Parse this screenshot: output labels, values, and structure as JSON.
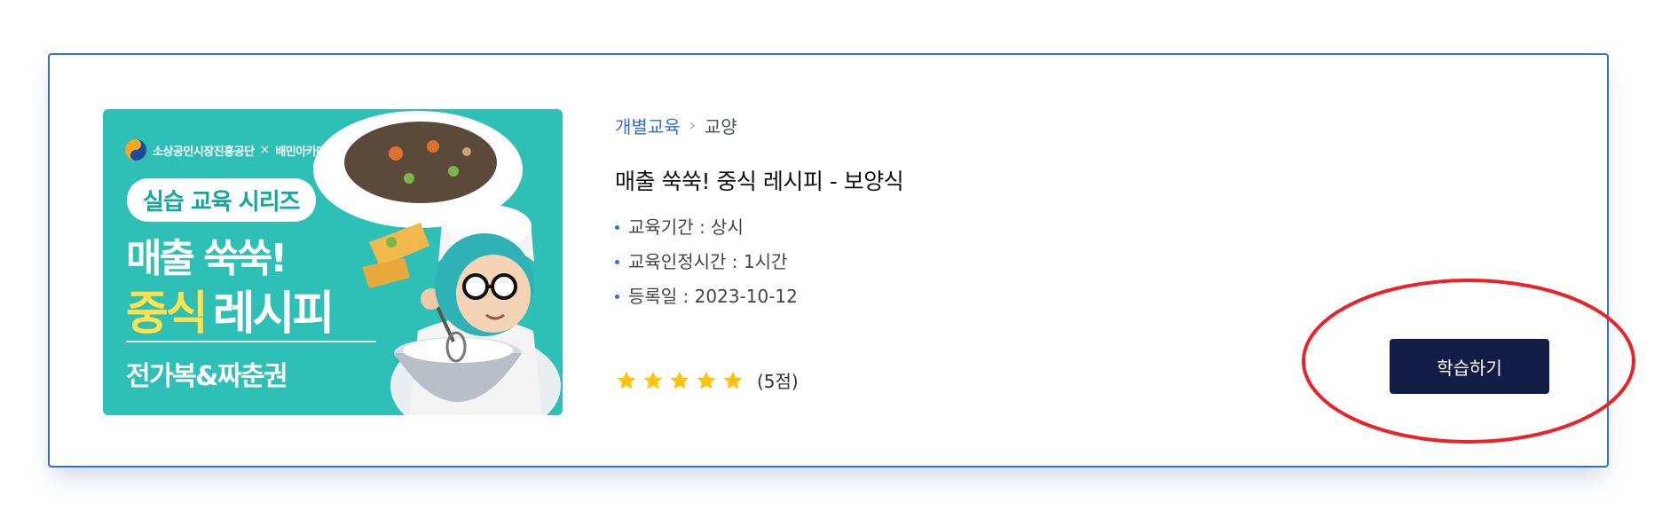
{
  "course": {
    "thumbnail": {
      "brand_left": "소상공인시장진흥공단",
      "brand_x": "×",
      "brand_right": "배민아카데미",
      "series": "실습 교육 시리즈",
      "headline_1": "매출 쑥쑥!",
      "headline_2_highlight": "중식",
      "headline_2_rest": "레시피",
      "author": "전가복&짜춘권"
    },
    "breadcrumb": {
      "category": "개별교육",
      "separator": "›",
      "subcategory": "교양"
    },
    "title": "매출 쑥쑥! 중식 레시피 - 보양식",
    "info": [
      "교육기간 : 상시",
      "교육인정시간 : 1시간",
      "등록일 : 2023-10-12"
    ],
    "rating": {
      "stars": 5,
      "label": "(5점)",
      "star_icon": "star-icon"
    },
    "action": {
      "study_label": "학습하기"
    }
  },
  "colors": {
    "accent": "#2f6fd7",
    "button_bg": "#131c46",
    "thumbnail_bg": "#2ec0b6",
    "star": "#ffc20e",
    "annotation": "#e8232a"
  }
}
